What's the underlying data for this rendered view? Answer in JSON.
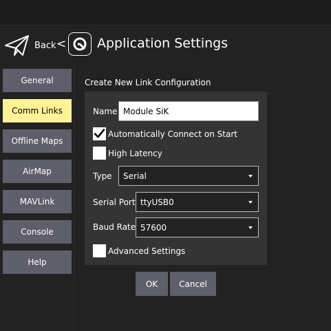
{
  "header": {
    "back_label": "Back",
    "back_chevron": "<",
    "title": "Application Settings",
    "back_icon": "paper-plane-icon",
    "app_icon": "qgc-logo-icon"
  },
  "sidebar": {
    "items": [
      {
        "label": "General",
        "active": false
      },
      {
        "label": "Comm Links",
        "active": true
      },
      {
        "label": "Offline Maps",
        "active": false
      },
      {
        "label": "AirMap",
        "active": false
      },
      {
        "label": "MAVLink",
        "active": false
      },
      {
        "label": "Console",
        "active": false
      },
      {
        "label": "Help",
        "active": false
      }
    ]
  },
  "form": {
    "section_title": "Create New Link Configuration",
    "name_label": "Name",
    "name_value": "Module SiK",
    "auto_connect_label": "Automatically Connect on Start",
    "auto_connect_checked": true,
    "high_latency_label": "High Latency",
    "high_latency_checked": false,
    "type_label": "Type",
    "type_value": "Serial",
    "serial_port_label": "Serial Port",
    "serial_port_value": "ttyUSB0",
    "baud_rate_label": "Baud Rate",
    "baud_rate_value": "57600",
    "advanced_label": "Advanced Settings",
    "advanced_checked": false
  },
  "actions": {
    "ok_label": "OK",
    "cancel_label": "Cancel"
  },
  "colors": {
    "background": "#222222",
    "button": "#5f5f6b",
    "active_button": "#fff297",
    "panel": "#343434"
  }
}
